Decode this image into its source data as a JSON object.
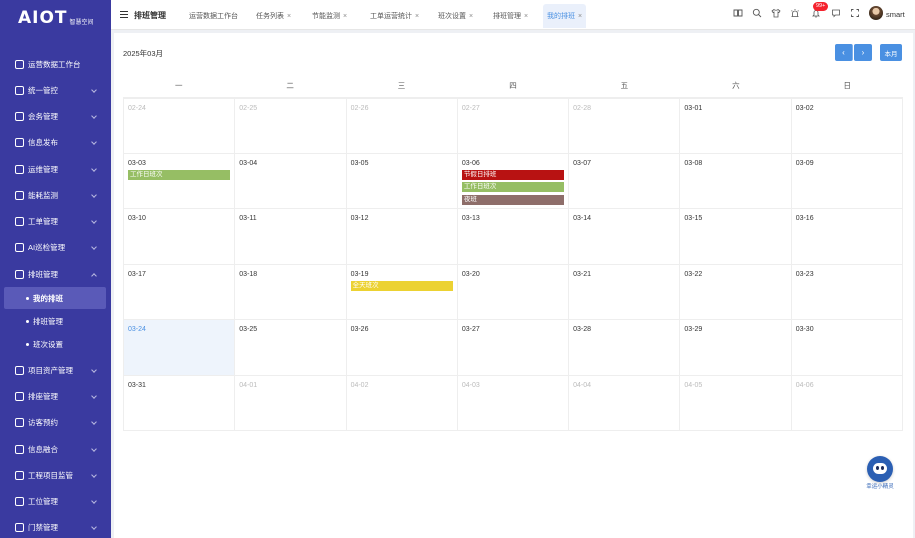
{
  "logo": {
    "text": "AIOT",
    "sub": "智慧空间"
  },
  "sidebar": {
    "items": [
      {
        "label": "运营数据工作台",
        "icon": "monitor-icon",
        "chevron": false
      },
      {
        "label": "统一管控",
        "icon": "control-icon",
        "chevron": true
      },
      {
        "label": "会务管理",
        "icon": "meeting-icon",
        "chevron": true
      },
      {
        "label": "信息发布",
        "icon": "publish-icon",
        "chevron": true
      },
      {
        "label": "运维管理",
        "icon": "ops-icon",
        "chevron": true
      },
      {
        "label": "能耗监测",
        "icon": "energy-icon",
        "chevron": true
      },
      {
        "label": "工单管理",
        "icon": "ticket-icon",
        "chevron": true
      },
      {
        "label": "AI巡检管理",
        "icon": "inspect-icon",
        "chevron": true
      },
      {
        "label": "排班管理",
        "icon": "calendar-icon",
        "chevron": true,
        "expanded": true
      },
      {
        "label": "项目资产管理",
        "icon": "asset-icon",
        "chevron": true
      },
      {
        "label": "排座管理",
        "icon": "seat-icon",
        "chevron": true
      },
      {
        "label": "访客预约",
        "icon": "visitor-icon",
        "chevron": true
      },
      {
        "label": "信息融合",
        "icon": "fusion-icon",
        "chevron": true
      },
      {
        "label": "工程项目监管",
        "icon": "project-icon",
        "chevron": true
      },
      {
        "label": "工位管理",
        "icon": "desk-icon",
        "chevron": true
      },
      {
        "label": "门禁管理",
        "icon": "door-icon",
        "chevron": true
      }
    ],
    "subitems": [
      {
        "label": "我的排班",
        "active": true
      },
      {
        "label": "排班管理",
        "active": false
      },
      {
        "label": "班次设置",
        "active": false
      }
    ]
  },
  "topbar": {
    "page_name": "排班管理",
    "tabs": [
      {
        "label": "运营数据工作台",
        "closable": false
      },
      {
        "label": "任务列表",
        "closable": true
      },
      {
        "label": "节能监测",
        "closable": true
      },
      {
        "label": "工单运营统计",
        "closable": true
      },
      {
        "label": "班次设置",
        "closable": true
      },
      {
        "label": "排班管理",
        "closable": true
      },
      {
        "label": "我的排班",
        "closable": true,
        "active": true
      }
    ],
    "close_glyph": "×",
    "badge": "99+",
    "username": "smart"
  },
  "calendar": {
    "month_label": "2025年03月",
    "prev_glyph": "‹",
    "next_glyph": "›",
    "today_label": "本月",
    "weekdays": [
      "一",
      "二",
      "三",
      "四",
      "五",
      "六",
      "日"
    ],
    "weeks": [
      [
        {
          "d": "02-24",
          "muted": true
        },
        {
          "d": "02-25",
          "muted": true
        },
        {
          "d": "02-26",
          "muted": true
        },
        {
          "d": "02-27",
          "muted": true
        },
        {
          "d": "02-28",
          "muted": true
        },
        {
          "d": "03-01"
        },
        {
          "d": "03-02"
        }
      ],
      [
        {
          "d": "03-03",
          "events": [
            {
              "label": "工作日班次",
              "color": "#96be64"
            }
          ]
        },
        {
          "d": "03-04"
        },
        {
          "d": "03-05"
        },
        {
          "d": "03-06",
          "events": [
            {
              "label": "节假日排班",
              "color": "#b81212"
            },
            {
              "label": "工作日班次",
              "color": "#96be64"
            },
            {
              "label": "夜班",
              "color": "#8e6e6a"
            }
          ]
        },
        {
          "d": "03-07"
        },
        {
          "d": "03-08"
        },
        {
          "d": "03-09"
        }
      ],
      [
        {
          "d": "03-10"
        },
        {
          "d": "03-11"
        },
        {
          "d": "03-12"
        },
        {
          "d": "03-13"
        },
        {
          "d": "03-14"
        },
        {
          "d": "03-15"
        },
        {
          "d": "03-16"
        }
      ],
      [
        {
          "d": "03-17"
        },
        {
          "d": "03-18"
        },
        {
          "d": "03-19",
          "events": [
            {
              "label": "全天班次",
              "color": "#ecd232"
            }
          ]
        },
        {
          "d": "03-20"
        },
        {
          "d": "03-21"
        },
        {
          "d": "03-22"
        },
        {
          "d": "03-23"
        }
      ],
      [
        {
          "d": "03-24",
          "today": true
        },
        {
          "d": "03-25"
        },
        {
          "d": "03-26"
        },
        {
          "d": "03-27"
        },
        {
          "d": "03-28"
        },
        {
          "d": "03-29"
        },
        {
          "d": "03-30"
        }
      ],
      [
        {
          "d": "03-31"
        },
        {
          "d": "04-01",
          "muted": true
        },
        {
          "d": "04-02",
          "muted": true
        },
        {
          "d": "04-03",
          "muted": true
        },
        {
          "d": "04-04",
          "muted": true
        },
        {
          "d": "04-05",
          "muted": true
        },
        {
          "d": "04-06",
          "muted": true
        }
      ]
    ]
  },
  "assistant": {
    "label": "幸运小精灵"
  }
}
